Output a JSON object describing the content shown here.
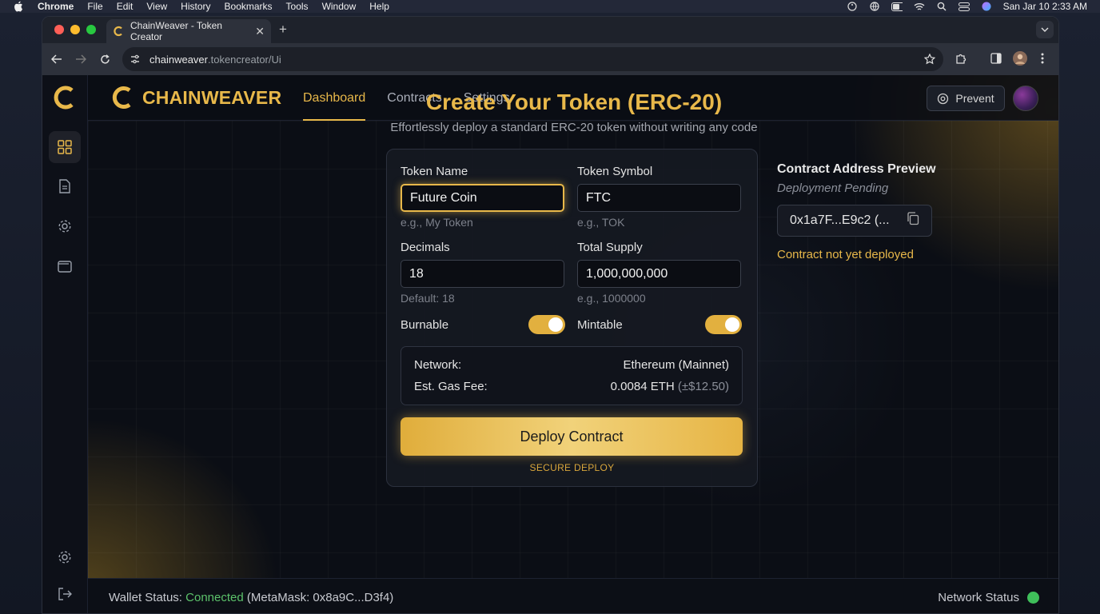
{
  "menubar": {
    "app": "Chrome",
    "items": [
      "File",
      "Edit",
      "View",
      "History",
      "Bookmarks",
      "Tools",
      "Window",
      "Help"
    ],
    "clock": "San Jar 10  2:33 AM"
  },
  "browser": {
    "tab_title": "ChainWeaver - Token Creator",
    "url_host": "chainweaver",
    "url_rest": ".tokencreator/Ui"
  },
  "app": {
    "brand": "CHAINWEAVER",
    "nav": [
      "Dashboard",
      "Contracts",
      "Settings"
    ],
    "active_nav": "Dashboard",
    "prevent_label": "Prevent",
    "accent": "#e8b84a"
  },
  "hero": {
    "title": "Create Your Token (ERC-20)",
    "subtitle": "Effortlessly deploy a standard ERC-20 token without writing any code"
  },
  "form": {
    "token_name": {
      "label": "Token Name",
      "value": "Future Coin",
      "hint": "e.g., My Token"
    },
    "token_symbol": {
      "label": "Token Symbol",
      "value": "FTC",
      "hint": "e.g., TOK"
    },
    "decimals": {
      "label": "Decimals",
      "value": "18",
      "hint": "Default: 18"
    },
    "total_supply": {
      "label": "Total Supply",
      "value": "1,000,000,000",
      "hint": "e.g., 1000000"
    },
    "burnable": {
      "label": "Burnable",
      "on": true
    },
    "mintable": {
      "label": "Mintable",
      "on": true
    },
    "network_label": "Network:",
    "network_value": "Ethereum (Mainnet)",
    "gas_label": "Est. Gas Fee:",
    "gas_value": "0.0084 ETH",
    "gas_usd": "(±$12.50)",
    "deploy_label": "Deploy Contract",
    "secure_label": "SECURE DEPLOY"
  },
  "preview": {
    "title": "Contract Address Preview",
    "subtitle": "Deployment Pending",
    "address": "0x1a7F...E9c2 (...",
    "status": "Contract not yet deployed"
  },
  "statusbar": {
    "wallet_label": "Wallet Status:",
    "wallet_state": "Connected",
    "wallet_detail": "(MetaMask: 0x8a9C...D3f4)",
    "network_label": "Network Status"
  }
}
